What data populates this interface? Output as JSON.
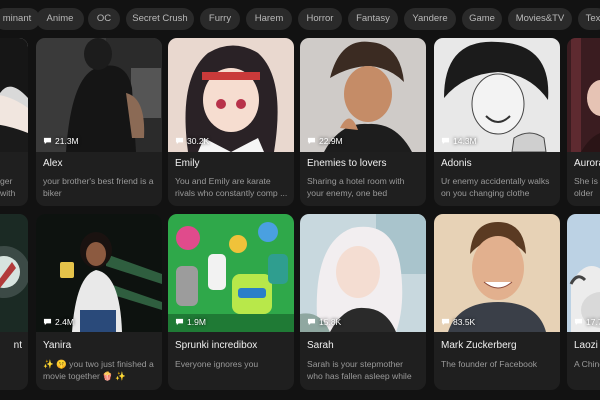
{
  "categories": [
    "minant",
    "Anime",
    "OC",
    "Secret Crush",
    "Furry",
    "Harem",
    "Horror",
    "Fantasy",
    "Yandere",
    "Game",
    "Movies&TV",
    "Tex"
  ],
  "cards_row1": [
    {
      "name": "",
      "count": "",
      "desc": "ger\nwith"
    },
    {
      "name": "Alex",
      "count": "21.3M",
      "desc": "your brother's best friend is a biker"
    },
    {
      "name": "Emily",
      "count": "30.2K",
      "desc": "You and Emily are karate rivals who constantly comp ..."
    },
    {
      "name": "Enemies to lovers",
      "count": "22.9M",
      "desc": "Sharing a hotel room with your enemy, one bed"
    },
    {
      "name": "Adonis",
      "count": "14.3M",
      "desc": "Ur enemy accidentally walks on you changing clothe"
    },
    {
      "name": "Aurora",
      "count": "",
      "desc": "She is is older"
    }
  ],
  "cards_row2": [
    {
      "name": "nt",
      "count": "",
      "desc": ""
    },
    {
      "name": "Yanira",
      "count": "2.4M",
      "desc": "✨ 🤫 you two just finished a movie together 🍿 ✨"
    },
    {
      "name": "Sprunki incredibox",
      "count": "1.9M",
      "desc": "Everyone ignores you"
    },
    {
      "name": "Sarah",
      "count": "15.8K",
      "desc": "Sarah is your stepmother who has fallen asleep while ..."
    },
    {
      "name": "Mark Zuckerberg",
      "count": "83.5K",
      "desc": "The founder of Facebook"
    },
    {
      "name": "Laozi",
      "count": "17.7",
      "desc": "A Chine"
    }
  ],
  "icons": {
    "stats": "chat-bubble-icon"
  },
  "colors": {
    "background": "#121212",
    "card": "#1f1f1f",
    "chip": "#2a2a2a"
  }
}
